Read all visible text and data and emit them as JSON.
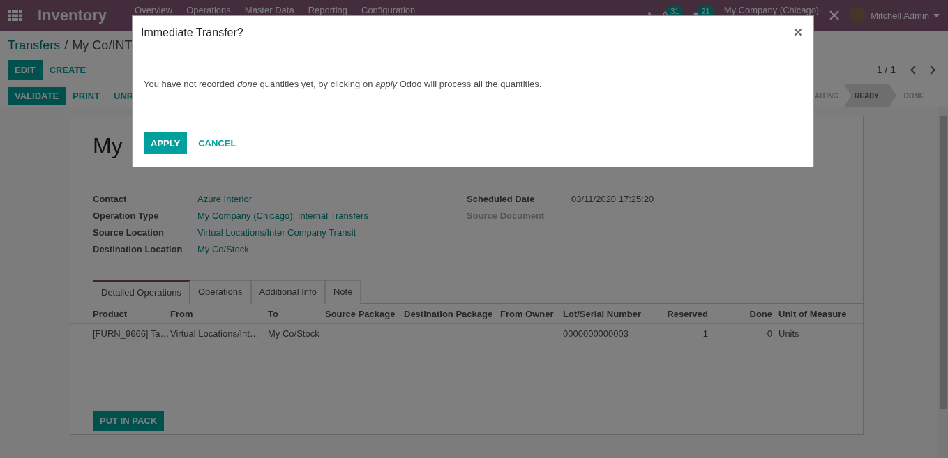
{
  "navbar": {
    "app_name": "Inventory",
    "menus": [
      "Overview",
      "Operations",
      "Master Data",
      "Reporting",
      "Configuration"
    ],
    "activity_count": "31",
    "message_count": "21",
    "company": "My Company (Chicago)",
    "user": "Mitchell Admin"
  },
  "breadcrumb": {
    "parent": "Transfers",
    "separator": "/",
    "current": "My Co/INT"
  },
  "buttons": [
    "EDIT",
    "CREATE"
  ],
  "pager": "1 / 1",
  "action_buttons": [
    {
      "label": "VALIDATE",
      "primary": true
    },
    {
      "label": "PRINT",
      "primary": false
    },
    {
      "label": "UNR",
      "primary": false
    }
  ],
  "status_stages": [
    {
      "label": "AITING",
      "selected": false
    },
    {
      "label": "READY",
      "selected": true
    },
    {
      "label": "DONE",
      "selected": false
    }
  ],
  "record_title": "My",
  "fields_left": [
    {
      "label": "Contact",
      "value": "Azure Interior"
    },
    {
      "label": "Operation Type",
      "value": "My Company (Chicago): Internal Transfers"
    },
    {
      "label": "Source Location",
      "value": "Virtual Locations/Inter Company Transit"
    },
    {
      "label": "Destination Location",
      "value": "My Co/Stock"
    }
  ],
  "fields_right": [
    {
      "label": "Scheduled Date",
      "value": "03/11/2020 17:25:20"
    },
    {
      "label": "Source Document"
    }
  ],
  "tabs": [
    {
      "label": "Detailed Operations",
      "selected": true
    },
    {
      "label": "Operations",
      "selected": false
    },
    {
      "label": "Additional Info",
      "selected": false
    },
    {
      "label": "Note",
      "selected": false
    }
  ],
  "table": {
    "columns": [
      "Product",
      "From",
      "To",
      "Source Package",
      "Destination Package",
      "From Owner",
      "Lot/Serial Number",
      "Reserved",
      "Done",
      "Unit of Measure"
    ],
    "rows": [
      [
        "[FURN_9666] Ta…",
        "Virtual Locations/Int…",
        "My Co/Stock",
        "",
        "",
        "",
        "0000000000003",
        "1",
        "0",
        "Units"
      ]
    ]
  },
  "put_in_pack": "PUT IN PACK",
  "dialog": {
    "title": "Immediate Transfer?",
    "close": "×",
    "message": "You have not recorded *done* quantities yet, by clicking on *apply* Odoo will process all the quantities.",
    "buttons": [
      {
        "label": "APPLY",
        "primary": true
      },
      {
        "label": "CANCEL",
        "primary": false
      }
    ]
  }
}
